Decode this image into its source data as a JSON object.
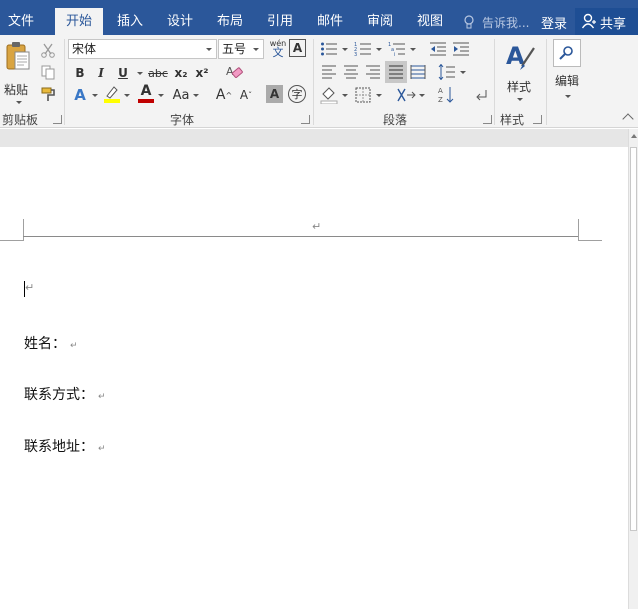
{
  "tabs": [
    {
      "label": "文件",
      "active": false
    },
    {
      "label": "开始",
      "active": true
    },
    {
      "label": "插入",
      "active": false
    },
    {
      "label": "设计",
      "active": false
    },
    {
      "label": "布局",
      "active": false
    },
    {
      "label": "引用",
      "active": false
    },
    {
      "label": "邮件",
      "active": false
    },
    {
      "label": "审阅",
      "active": false
    },
    {
      "label": "视图",
      "active": false
    }
  ],
  "tell_me": "告诉我...",
  "sign_in": "登录",
  "share": "共享",
  "clipboard": {
    "paste_label": "粘贴",
    "group_label": "剪贴板"
  },
  "font": {
    "name": "宋体",
    "size": "五号",
    "phonetic_top": "wén",
    "phonetic_bottom": "文",
    "border_char": "A",
    "bold": "B",
    "italic": "I",
    "underline": "U",
    "strike": "abc",
    "subscript": "x₂",
    "superscript": "x²",
    "effects": "A",
    "color_letter": "A",
    "case": "Aa",
    "grow": "A",
    "grow_sup": "^",
    "shrink": "A",
    "shrink_sup": "ˇ",
    "shade_char": "A",
    "enclose_char": "字",
    "group_label": "字体"
  },
  "paragraph": {
    "group_label": "段落"
  },
  "styles": {
    "label": "样式",
    "group_label": "样式"
  },
  "editing": {
    "label": "编辑"
  },
  "colors": {
    "tabbar": "#2b579a",
    "highlight": "#ffff00",
    "font_color": "#c00000",
    "accent": "#2b579a"
  },
  "document": {
    "header_mark": "↵",
    "cursor_mark": "↵",
    "lines": [
      {
        "text": "姓名：",
        "mark": "↵"
      },
      {
        "text": "联系方式：",
        "mark": "↵"
      },
      {
        "text": "联系地址：",
        "mark": "↵"
      }
    ]
  }
}
